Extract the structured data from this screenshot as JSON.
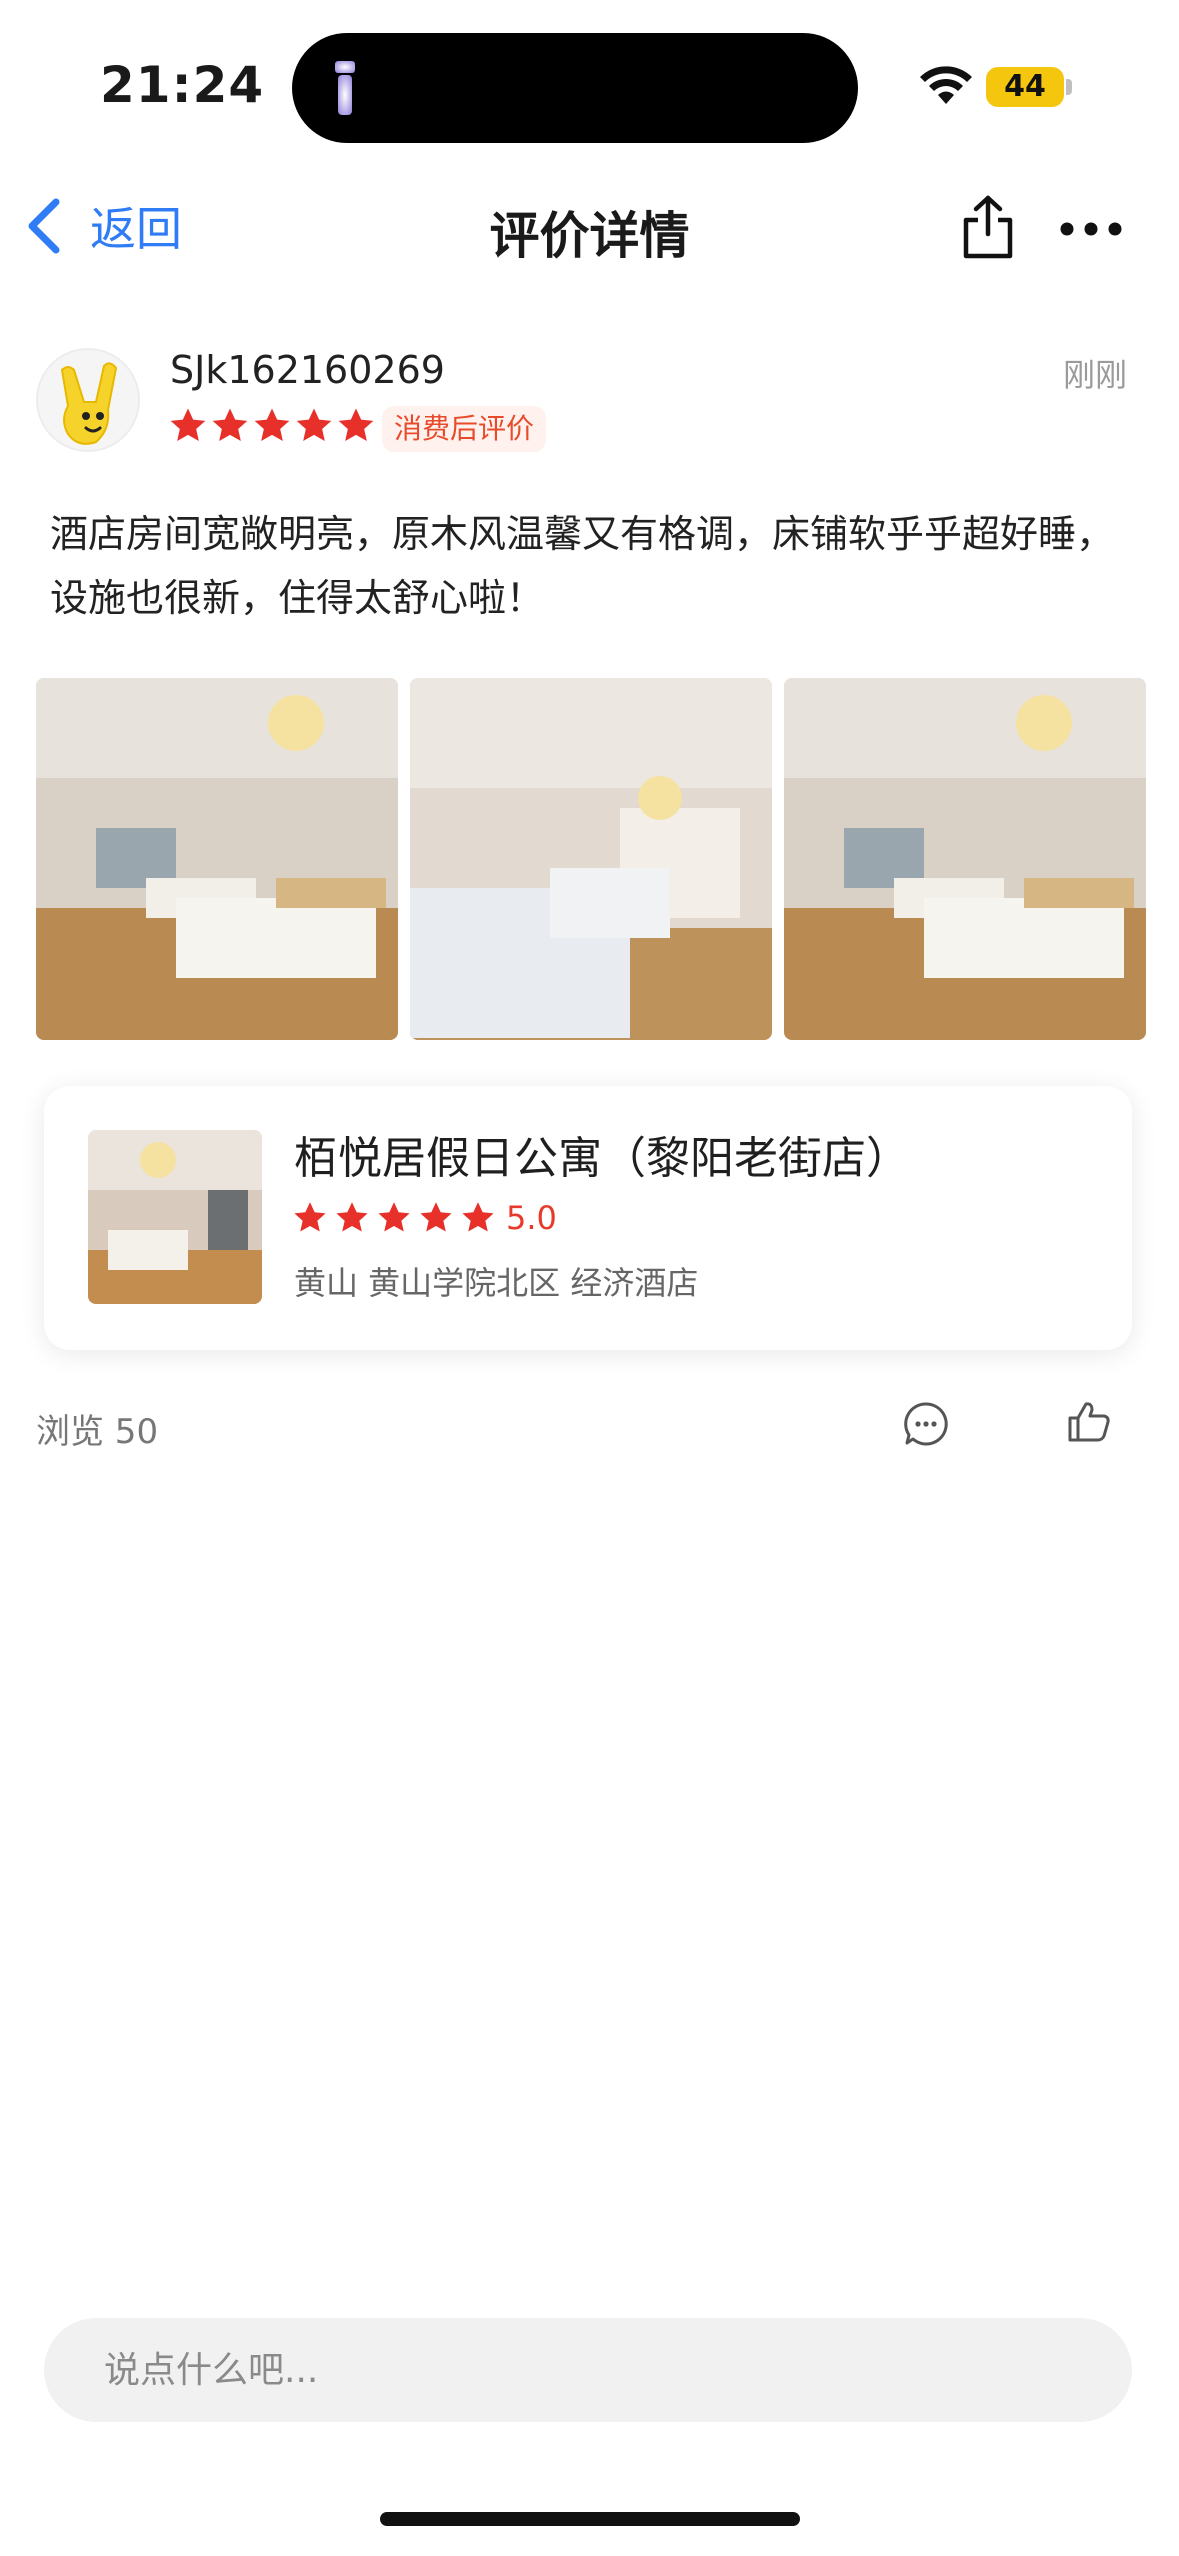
{
  "status_bar": {
    "time": "21:24",
    "battery": "44"
  },
  "nav": {
    "back_label": "返回",
    "title": "评价详情"
  },
  "review": {
    "username": "SJk162160269",
    "rating_stars": 5,
    "tag": "消费后评价",
    "time_ago": "刚刚",
    "content": "酒店房间宽敞明亮，原木风温馨又有格调，床铺软乎乎超好睡，设施也很新，住得太舒心啦！",
    "photo_count": 3
  },
  "hotel": {
    "name": "栢悦居假日公寓（黎阳老街店）",
    "rating_stars": 5,
    "score": "5.0",
    "meta": "黄山 黄山学院北区 经济酒店"
  },
  "stats": {
    "views": "浏览 50"
  },
  "comment": {
    "placeholder": "说点什么吧..."
  },
  "colors": {
    "accent": "#2f7cf6",
    "star": "#e8302a",
    "tag_bg": "#fff1ed",
    "tag_text": "#e84b2a"
  }
}
